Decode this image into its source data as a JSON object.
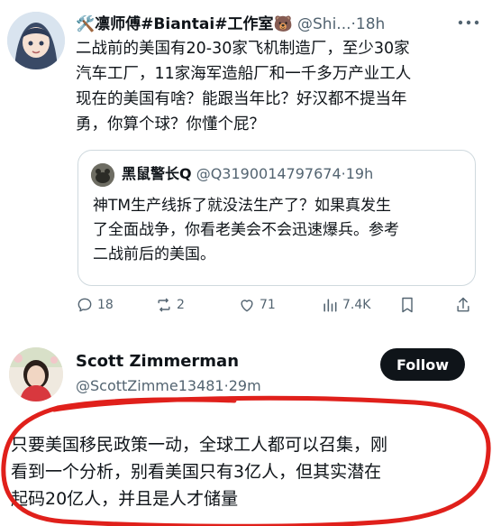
{
  "tweet1": {
    "name": "🛠️凛师傅#Biantai#工作室🐻",
    "handle": "@Shi...",
    "time": "18h",
    "more_icon": "more-horizontal-icon",
    "text_lines": [
      "二战前的美国有20-30家飞机制造厂，至少30家",
      "汽车工厂，11家海军造船厂和一千多万产业工人",
      "现在的美国有啥？能跟当年比？好汉都不提当年",
      "勇，你算个球？你懂个屁？"
    ],
    "quote": {
      "name": "黑鼠警长Q",
      "handle": "@Q3190014797674",
      "time": "19h",
      "text_lines": [
        "神TM生产线拆了就没法生产了？如果真发生",
        "了全面战争，你看老美会不会迅速爆兵。参考",
        "二战前后的美国。"
      ]
    },
    "actions": {
      "replies": "18",
      "reposts": "2",
      "likes": "71",
      "views": "7.4K"
    }
  },
  "tweet2": {
    "name": "Scott Zimmerman",
    "handle": "@ScottZimme13481",
    "time": "29m",
    "follow_label": "Follow",
    "text_lines": [
      "只要美国移民政策一动，全球工人都可以召集，刚",
      "看到一个分析，别看美国只有3亿人，但其实潜在",
      "起码20亿人，并且是人才储量"
    ]
  },
  "colors": {
    "text": "#0f1419",
    "muted": "#536471",
    "border": "#cfd9de",
    "annotation": "#e0201b"
  }
}
